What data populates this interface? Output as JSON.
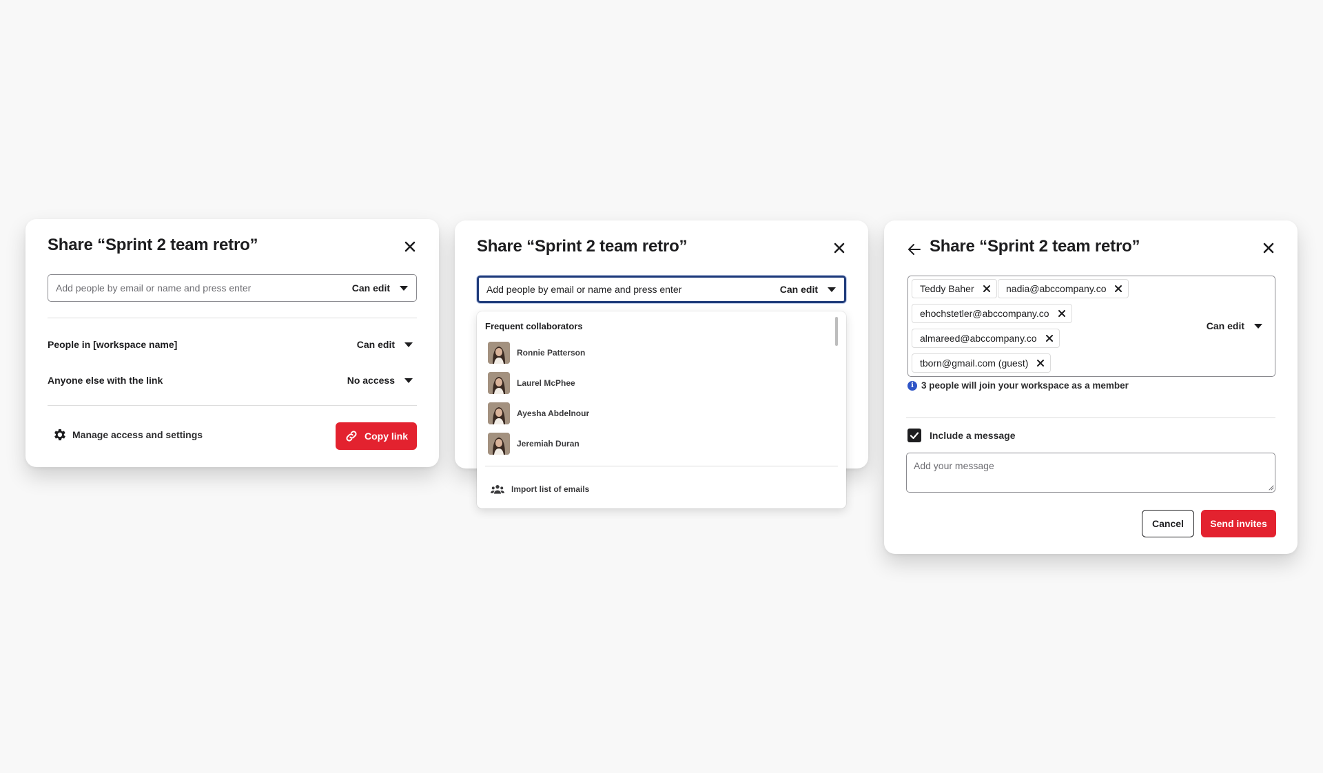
{
  "colors": {
    "accent": "#e3222f",
    "focus": "#1f3b7a",
    "info": "#2f55c7",
    "text": "#1d1d1f"
  },
  "modal1": {
    "title": "Share “Sprint 2 team retro”",
    "input_placeholder": "Add people by email or name and press enter",
    "input_permission": "Can edit",
    "workspace_row": {
      "label": "People in [workspace name]",
      "permission": "Can edit"
    },
    "link_row": {
      "label": "Anyone else with the link",
      "permission": "No access"
    },
    "manage_label": "Manage access and settings",
    "copy_label": "Copy link"
  },
  "modal2": {
    "title": "Share “Sprint 2 team retro”",
    "input_value": "Add people by email or name and press enter",
    "input_permission": "Can edit",
    "dropdown": {
      "heading": "Frequent collaborators",
      "collaborators": [
        {
          "name": "Ronnie Patterson"
        },
        {
          "name": "Laurel McPhee"
        },
        {
          "name": "Ayesha Abdelnour"
        },
        {
          "name": "Jeremiah Duran"
        }
      ],
      "import_label": "Import list of emails"
    }
  },
  "modal3": {
    "title": "Share “Sprint 2 team retro”",
    "chips": [
      "Teddy Baher",
      "nadia@abccompany.co",
      "ehochstetler@abccompany.co",
      "almareed@abccompany.co",
      "tborn@gmail.com (guest)"
    ],
    "permission": "Can edit",
    "info_text": "3 people will join your workspace as a member",
    "include_message_label": "Include a message",
    "include_message_checked": true,
    "message_placeholder": "Add your message",
    "cancel_label": "Cancel",
    "send_label": "Send invites"
  }
}
